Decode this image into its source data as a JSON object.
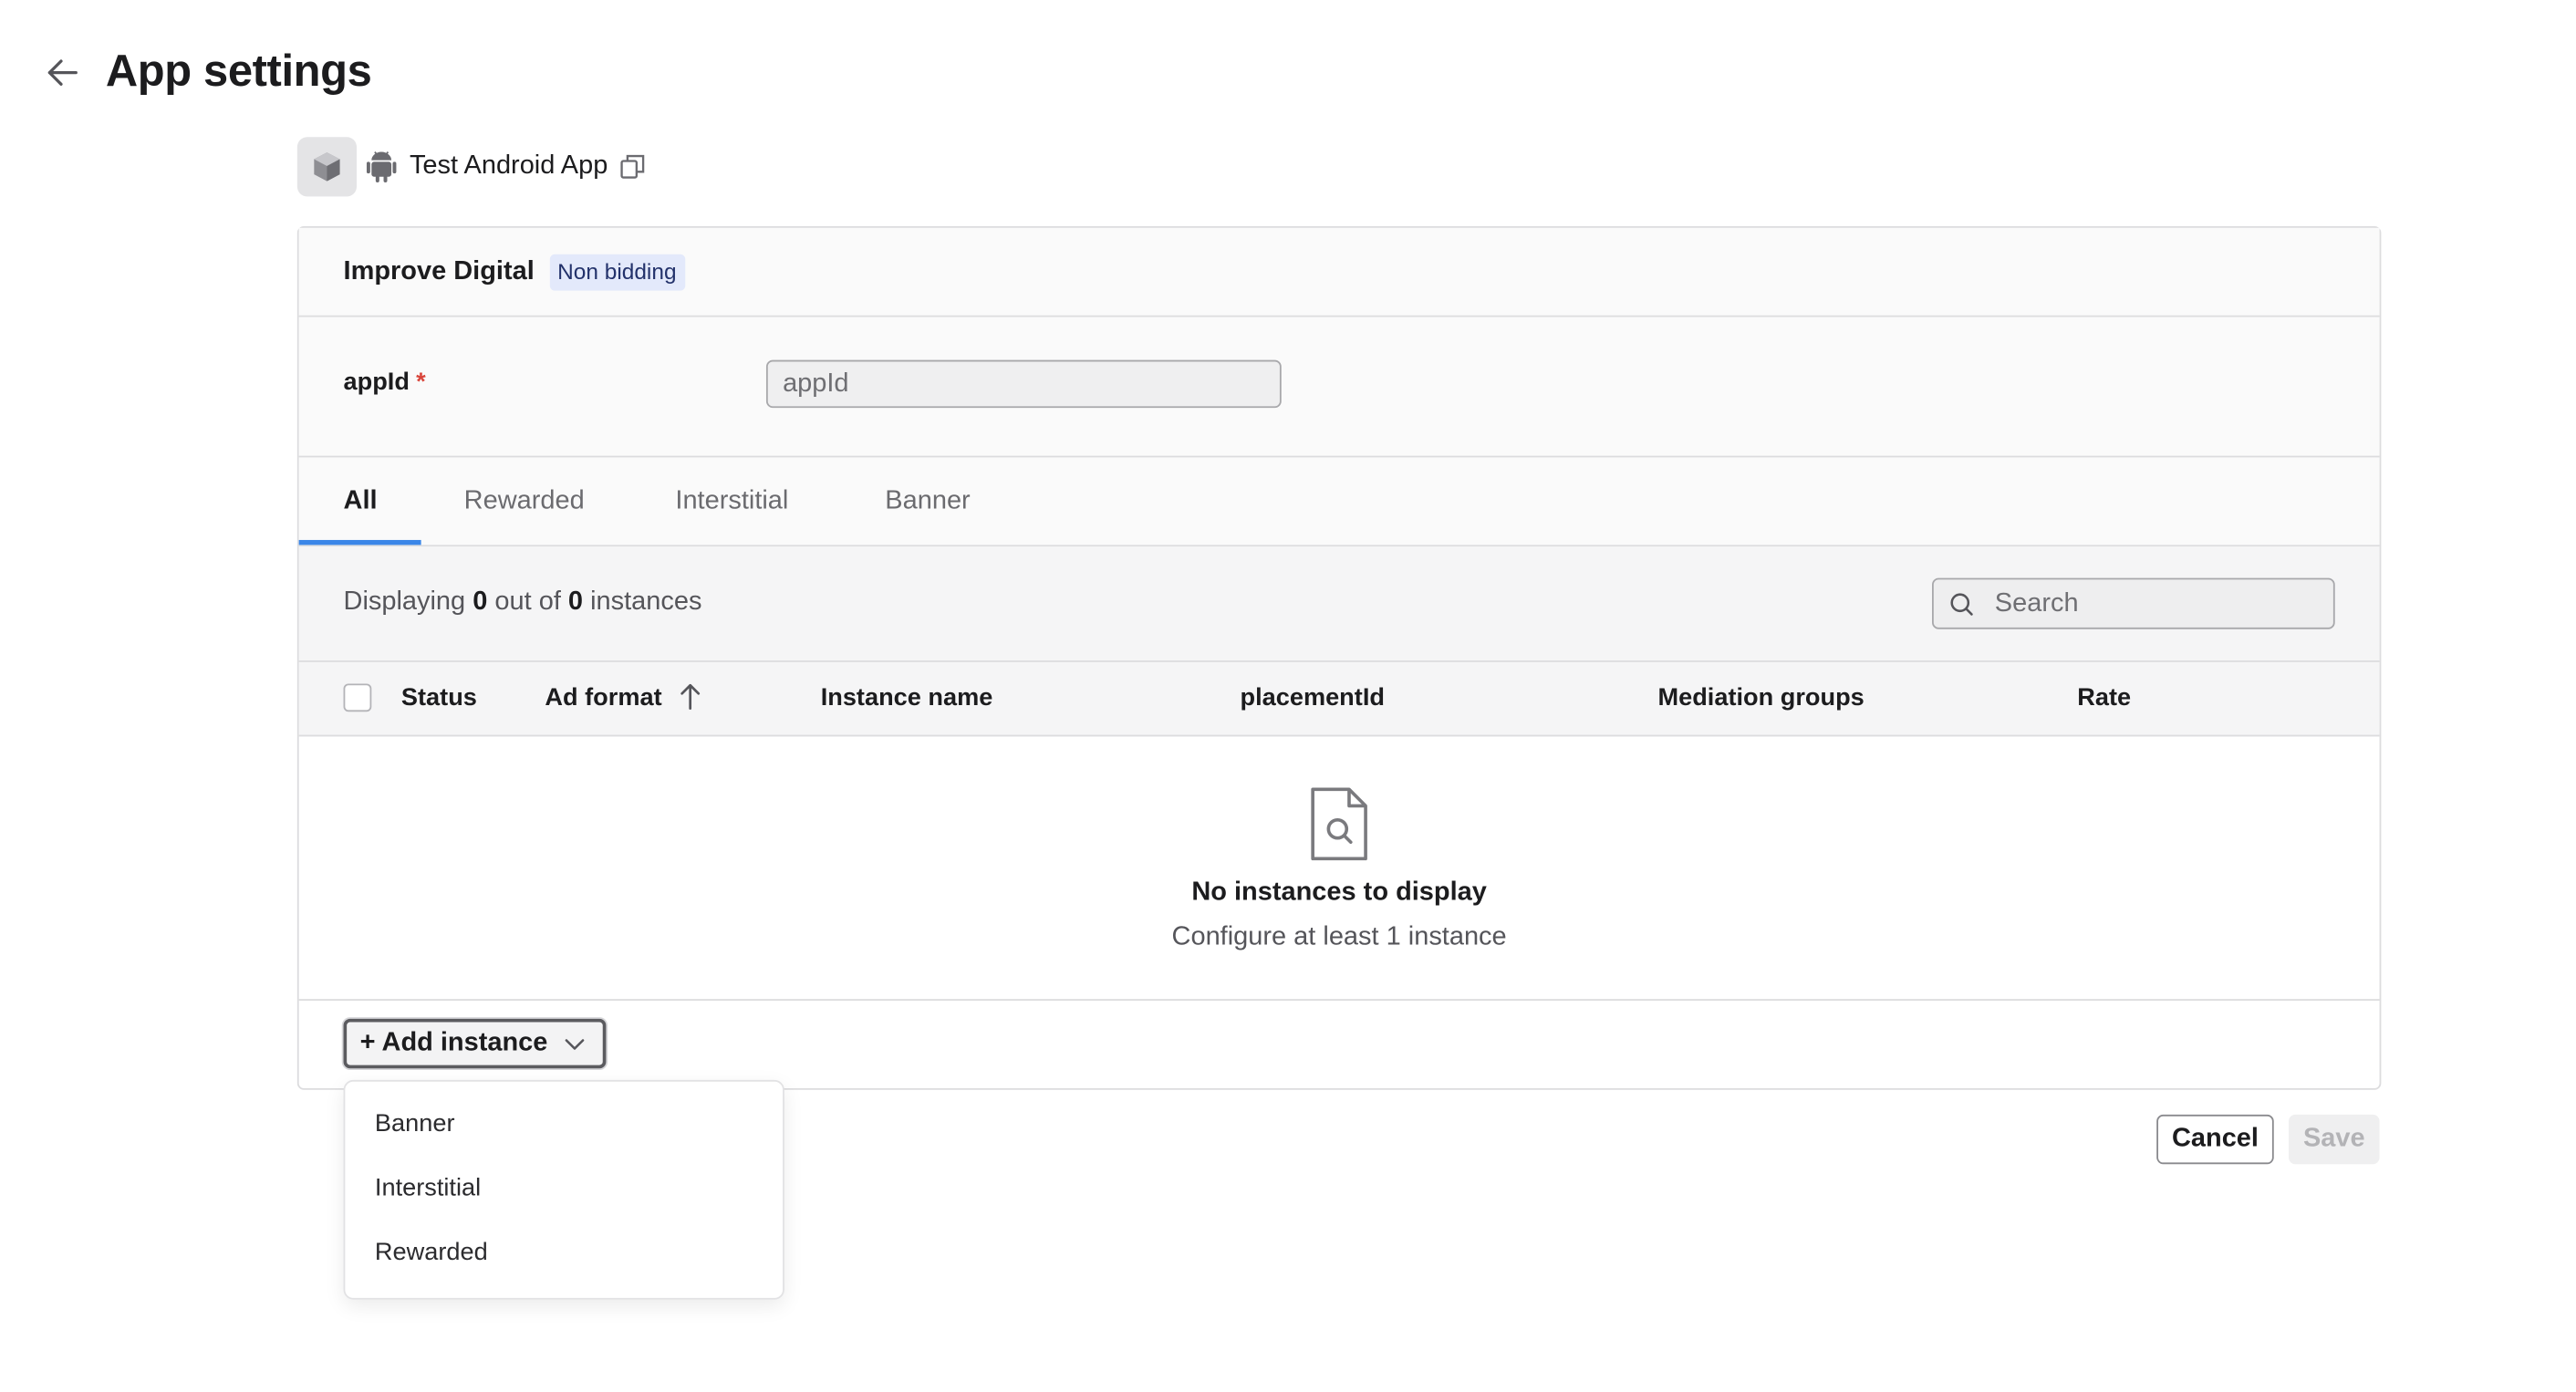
{
  "header": {
    "title": "App settings"
  },
  "app": {
    "name": "Test Android App"
  },
  "network": {
    "name": "Improve Digital",
    "badge": "Non bidding"
  },
  "field": {
    "label": "appId",
    "placeholder": "appId",
    "value": ""
  },
  "tabs": [
    {
      "label": "All",
      "active": true
    },
    {
      "label": "Rewarded",
      "active": false
    },
    {
      "label": "Interstitial",
      "active": false
    },
    {
      "label": "Banner",
      "active": false
    }
  ],
  "toolbar": {
    "display_prefix": "Displaying",
    "shown_count": "0",
    "display_mid": "out of",
    "total_count": "0",
    "display_suffix": "instances",
    "search_placeholder": "Search"
  },
  "table": {
    "columns": [
      "Status",
      "Ad format",
      "Instance name",
      "placementId",
      "Mediation groups",
      "Rate"
    ],
    "sort_column": "Ad format",
    "sort_direction": "ascending"
  },
  "empty_state": {
    "title": "No instances to display",
    "subtitle": "Configure at least 1 instance"
  },
  "add_instance": {
    "label": "+ Add instance",
    "menu": [
      "Banner",
      "Interstitial",
      "Rewarded"
    ]
  },
  "footer": {
    "cancel": "Cancel",
    "save": "Save"
  },
  "colors": {
    "accent": "#3a86e8",
    "badge_bg": "#e3e9fb",
    "required": "#d9453b"
  }
}
